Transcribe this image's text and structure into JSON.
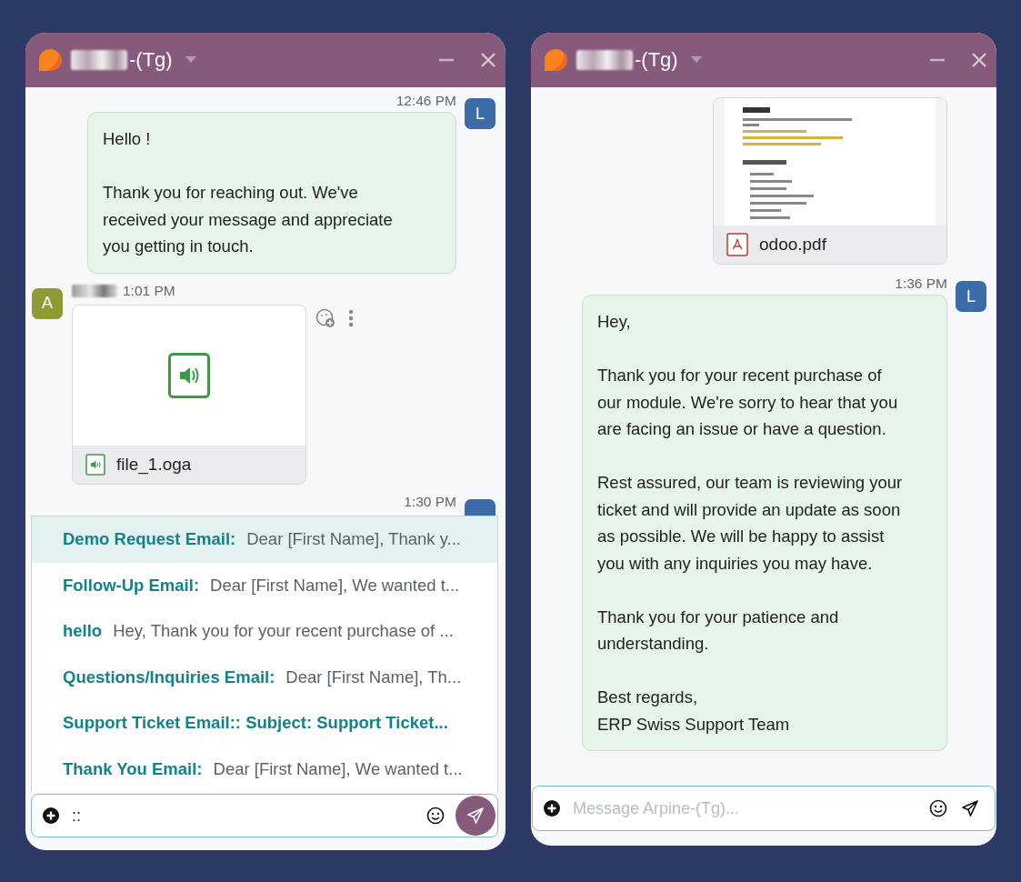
{
  "windows": [
    {
      "title": "-(Tg)",
      "messages": [
        {
          "kind": "outgoing",
          "time": "12:46 PM",
          "avatar": {
            "letter": "L",
            "color": "#3b6ca8"
          },
          "paragraphs": [
            "Hello !",
            "Thank you for reaching out. We've received your message and appreciate you getting in touch."
          ]
        },
        {
          "kind": "incoming",
          "time": "1:01 PM",
          "avatar": {
            "letter": "A",
            "color": "#8e9a32"
          },
          "attachment": {
            "kind": "audio",
            "name": "file_1.oga"
          }
        },
        {
          "kind": "outgoing",
          "time": "1:30 PM",
          "avatar": {
            "color": "#3b6ca8"
          }
        }
      ],
      "suggestions": [
        {
          "label": "Demo Request Email:",
          "description": "Dear [First Name], Thank y...",
          "selected": true
        },
        {
          "label": "Follow-Up Email:",
          "description": "Dear [First Name], We wanted t...",
          "selected": false
        },
        {
          "label": "hello",
          "description": "Hey, Thank you for your recent purchase of ...",
          "selected": false
        },
        {
          "label": "Questions/Inquiries Email:",
          "description": "Dear [First Name], Th...",
          "selected": false
        },
        {
          "label": "Support Ticket Email:: Subject: Support Ticket...",
          "selected": false
        },
        {
          "label": "Thank You Email:",
          "description": "Dear [First Name], We wanted t...",
          "selected": false
        }
      ],
      "composer": {
        "value": "::",
        "send_active": true
      }
    },
    {
      "title": "-(Tg)",
      "messages": [
        {
          "kind": "outgoing",
          "attachment": {
            "kind": "pdf",
            "name": "odoo.pdf"
          }
        },
        {
          "kind": "outgoing",
          "time": "1:36 PM",
          "avatar": {
            "letter": "L",
            "color": "#3b6ca8"
          },
          "paragraphs": [
            "Hey,",
            "Thank you for your recent purchase of our module. We're sorry to hear that you are facing an issue or have a question.",
            "Rest assured, our team is reviewing your ticket and will provide an update as soon as possible. We will be happy to assist you with any inquiries you may have.",
            "Thank you for your patience and understanding.",
            "Best regards,\nERP Swiss Support Team"
          ]
        }
      ],
      "composer": {
        "placeholder": "Message Arpine-(Tg)...",
        "send_active": false
      }
    }
  ]
}
